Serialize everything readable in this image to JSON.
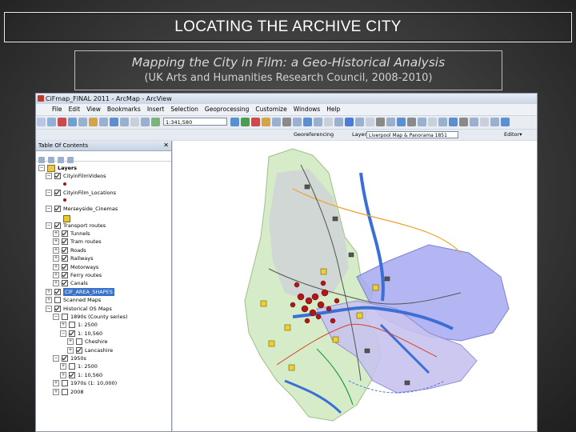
{
  "slide": {
    "title": "LOCATING THE ARCHIVE CITY",
    "subtitle_line1": "Mapping the City in Film: a Geo-Historical Analysis",
    "subtitle_line2": "(UK Arts and Humanities Research Council, 2008-2010)"
  },
  "arcmap": {
    "window_title": "CiFmap_FINAL 2011 - ArcMap - ArcView",
    "menu": [
      "File",
      "Edit",
      "View",
      "Bookmarks",
      "Insert",
      "Selection",
      "Geoprocessing",
      "Customize",
      "Windows",
      "Help"
    ],
    "scale_value": "1:341,580",
    "georef_label": "Georeferencing",
    "layer_label": "Layer:",
    "layer_value": "Liverpool Map & Panorama 1851",
    "editor_label": "Editor▾",
    "toc_title": "Table Of Contents",
    "toc_close": "✕",
    "toc": [
      {
        "label": "Layers",
        "indent": 0,
        "toggle": "-",
        "checkbox": null,
        "bold": true
      },
      {
        "label": "CityinFilmVideos",
        "indent": 1,
        "toggle": "-",
        "checkbox": true
      },
      {
        "label": "CityinFilm_Locations",
        "indent": 1,
        "toggle": "-",
        "checkbox": true
      },
      {
        "label": "Merseyside_Cinemas",
        "indent": 1,
        "toggle": "-",
        "checkbox": true
      },
      {
        "label": "Transport routes",
        "indent": 1,
        "toggle": "-",
        "checkbox": true
      },
      {
        "label": "Tunnels",
        "indent": 2,
        "toggle": "+",
        "checkbox": true
      },
      {
        "label": "Tram routes",
        "indent": 2,
        "toggle": "+",
        "checkbox": true
      },
      {
        "label": "Roads",
        "indent": 2,
        "toggle": "+",
        "checkbox": true
      },
      {
        "label": "Railways",
        "indent": 2,
        "toggle": "+",
        "checkbox": true
      },
      {
        "label": "Motorways",
        "indent": 2,
        "toggle": "+",
        "checkbox": true
      },
      {
        "label": "Ferry routes",
        "indent": 2,
        "toggle": "+",
        "checkbox": true
      },
      {
        "label": "Canals",
        "indent": 2,
        "toggle": "+",
        "checkbox": true
      },
      {
        "label": "CIF_AREA_SHAPES",
        "indent": 1,
        "toggle": "+",
        "checkbox": true,
        "selected": true
      },
      {
        "label": "Scanned Maps",
        "indent": 1,
        "toggle": "+",
        "checkbox": false
      },
      {
        "label": "Historical OS Maps",
        "indent": 1,
        "toggle": "-",
        "checkbox": true
      },
      {
        "label": "1890s (County series)",
        "indent": 2,
        "toggle": "-",
        "checkbox": false
      },
      {
        "label": "1: 2500",
        "indent": 3,
        "toggle": "+",
        "checkbox": false
      },
      {
        "label": "1: 10,560",
        "indent": 3,
        "toggle": "-",
        "checkbox": true
      },
      {
        "label": "Cheshire",
        "indent": 4,
        "toggle": "+",
        "checkbox": false
      },
      {
        "label": "Lancashire",
        "indent": 4,
        "toggle": "+",
        "checkbox": true
      },
      {
        "label": "1950s",
        "indent": 2,
        "toggle": "-",
        "checkbox": true
      },
      {
        "label": "1: 2500",
        "indent": 3,
        "toggle": "+",
        "checkbox": false
      },
      {
        "label": "1: 10,560",
        "indent": 3,
        "toggle": "+",
        "checkbox": true
      },
      {
        "label": "1970s (1: 10,000)",
        "indent": 2,
        "toggle": "+",
        "checkbox": false
      },
      {
        "label": "2008",
        "indent": 2,
        "toggle": "+",
        "checkbox": false
      }
    ]
  }
}
